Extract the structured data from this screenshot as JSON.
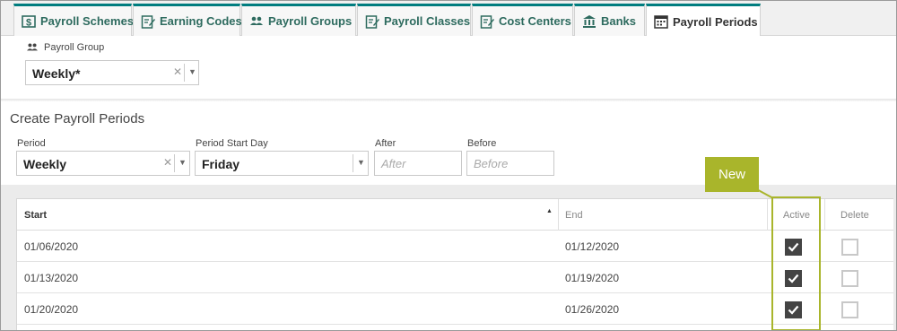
{
  "tabs": [
    {
      "label": "Payroll Schemes",
      "icon": "dollar-icon",
      "active": false
    },
    {
      "label": "Earning Codes",
      "icon": "edit-document-icon",
      "active": false
    },
    {
      "label": "Payroll Groups",
      "icon": "users-icon",
      "active": false
    },
    {
      "label": "Payroll Classes",
      "icon": "edit-document-icon",
      "active": false
    },
    {
      "label": "Cost Centers",
      "icon": "edit-document-icon",
      "active": false
    },
    {
      "label": "Banks",
      "icon": "bank-icon",
      "active": false
    },
    {
      "label": "Payroll Periods",
      "icon": "calendar-icon",
      "active": true
    }
  ],
  "payroll_group": {
    "label": "Payroll Group",
    "value": "Weekly*"
  },
  "create": {
    "title": "Create Payroll Periods",
    "period_label": "Period",
    "period_value": "Weekly",
    "start_day_label": "Period Start Day",
    "start_day_value": "Friday",
    "after_label": "After",
    "after_placeholder": "After",
    "before_label": "Before",
    "before_placeholder": "Before"
  },
  "callout": {
    "text": "New"
  },
  "grid": {
    "headers": {
      "start": "Start",
      "end": "End",
      "active": "Active",
      "delete": "Delete"
    },
    "rows": [
      {
        "start": "01/06/2020",
        "end": "01/12/2020",
        "active": true,
        "delete": false
      },
      {
        "start": "01/13/2020",
        "end": "01/19/2020",
        "active": true,
        "delete": false
      },
      {
        "start": "01/20/2020",
        "end": "01/26/2020",
        "active": true,
        "delete": false
      }
    ]
  },
  "colors": {
    "tab_accent": "#007d7f",
    "tab_text": "#2e6b5f",
    "callout": "#a9b52b"
  }
}
